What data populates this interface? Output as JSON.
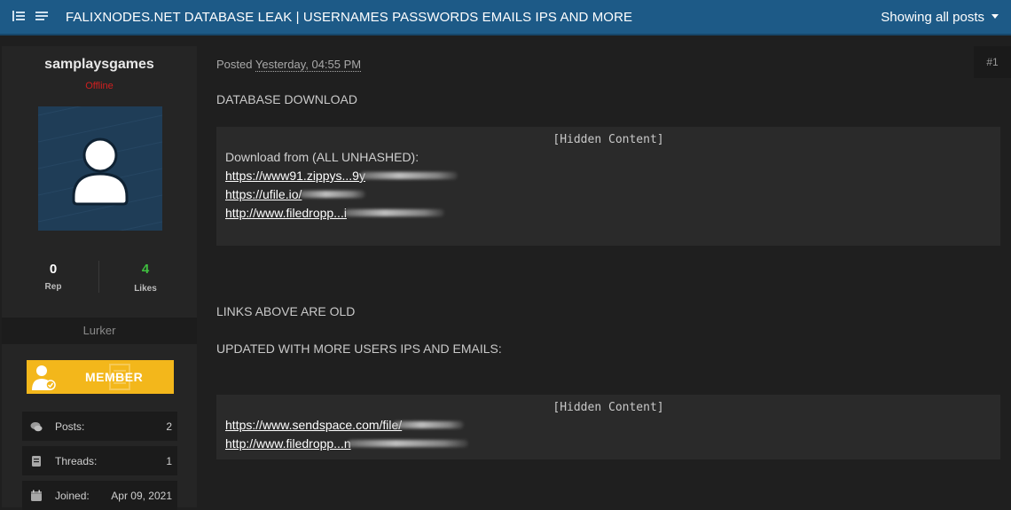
{
  "header": {
    "title": "FALIXNODES.NET DATABASE LEAK | USERNAMES PASSWORDS EMAILS IPS AND MORE",
    "showing": "Showing all posts"
  },
  "author": {
    "username": "samplaysgames",
    "status": "Offline",
    "rep_value": "0",
    "rep_label": "Rep",
    "likes_value": "4",
    "likes_label": "Likes",
    "rank": "Lurker",
    "badge": "MEMBER",
    "info": [
      {
        "icon": "chat-bubbles-icon",
        "label": "Posts:",
        "value": "2"
      },
      {
        "icon": "document-icon",
        "label": "Threads:",
        "value": "1"
      },
      {
        "icon": "calendar-icon",
        "label": "Joined:",
        "value": "Apr 09, 2021"
      }
    ]
  },
  "post": {
    "posted_label": "Posted",
    "timestamp": "Yesterday, 04:55 PM",
    "number": "#1",
    "line1": "DATABASE DOWNLOAD",
    "hidden_content_label": "[Hidden Content]",
    "box1": {
      "intro": "Download from (ALL UNHASHED):",
      "links": [
        "https://www91.zippys...9y",
        "https://ufile.io/",
        "http://www.filedropp...i"
      ]
    },
    "line2": "LINKS ABOVE ARE OLD",
    "line3": "UPDATED WITH MORE USERS IPS AND EMAILS:",
    "box2": {
      "links": [
        "https://www.sendspace.com/file/",
        "http://www.filedropp...n"
      ]
    }
  },
  "colors": {
    "header_bg": "#1d5a87",
    "offline": "#d02020",
    "likes": "#3fbf3f",
    "badge": "#f3b71b"
  }
}
